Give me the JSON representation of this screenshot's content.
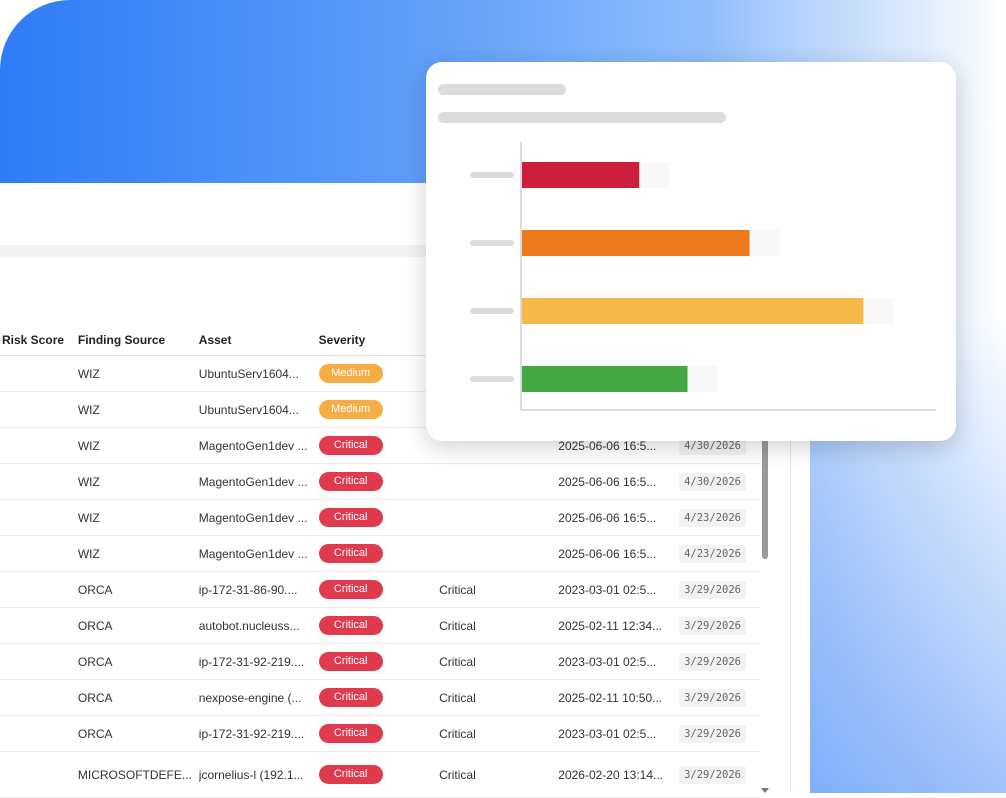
{
  "table": {
    "columns": [
      "Risk Score",
      "Finding Source",
      "Asset",
      "Severity",
      "",
      "",
      ""
    ],
    "rows": [
      {
        "source": "WIZ",
        "asset": "UbuntuServ1604...",
        "severity": "Medium",
        "severity_color": "#f6ad45",
        "severity2": "",
        "date": "",
        "due": ""
      },
      {
        "source": "WIZ",
        "asset": "UbuntuServ1604...",
        "severity": "Medium",
        "severity_color": "#f6ad45",
        "severity2": "",
        "date": "",
        "due": ""
      },
      {
        "source": "WIZ",
        "asset": "MagentoGen1dev ...",
        "severity": "Critical",
        "severity_color": "#e03a4e",
        "severity2": "",
        "date": "2025-06-06 16:5...",
        "due": "4/30/2026"
      },
      {
        "source": "WIZ",
        "asset": "MagentoGen1dev ...",
        "severity": "Critical",
        "severity_color": "#e03a4e",
        "severity2": "",
        "date": "2025-06-06 16:5...",
        "due": "4/30/2026"
      },
      {
        "source": "WIZ",
        "asset": "MagentoGen1dev ...",
        "severity": "Critical",
        "severity_color": "#e03a4e",
        "severity2": "",
        "date": "2025-06-06 16:5...",
        "due": "4/23/2026"
      },
      {
        "source": "WIZ",
        "asset": "MagentoGen1dev ...",
        "severity": "Critical",
        "severity_color": "#e03a4e",
        "severity2": "",
        "date": "2025-06-06 16:5...",
        "due": "4/23/2026"
      },
      {
        "source": "ORCA",
        "asset": "ip-172-31-86-90....",
        "severity": "Critical",
        "severity_color": "#e03a4e",
        "severity2": "Critical",
        "date": "2023-03-01 02:5...",
        "due": "3/29/2026"
      },
      {
        "source": "ORCA",
        "asset": "autobot.nucleuss...",
        "severity": "Critical",
        "severity_color": "#e03a4e",
        "severity2": "Critical",
        "date": "2025-02-11 12:34...",
        "due": "3/29/2026"
      },
      {
        "source": "ORCA",
        "asset": "ip-172-31-92-219....",
        "severity": "Critical",
        "severity_color": "#e03a4e",
        "severity2": "Critical",
        "date": "2023-03-01 02:5...",
        "due": "3/29/2026"
      },
      {
        "source": "ORCA",
        "asset": "nexpose-engine (...",
        "severity": "Critical",
        "severity_color": "#e03a4e",
        "severity2": "Critical",
        "date": "2025-02-11 10:50...",
        "due": "3/29/2026"
      },
      {
        "source": "ORCA",
        "asset": "ip-172-31-92-219....",
        "severity": "Critical",
        "severity_color": "#e03a4e",
        "severity2": "Critical",
        "date": "2023-03-01 02:5...",
        "due": "3/29/2026"
      },
      {
        "source": "MICROSOFTDEFE...",
        "asset": "jcornelius-l (192.1...",
        "severity": "Critical",
        "severity_color": "#e03a4e",
        "severity2": "Critical",
        "date": "2026-02-20 13:14...",
        "due": "3/29/2026"
      }
    ]
  },
  "chart_data": {
    "type": "bar",
    "orientation": "horizontal",
    "categories": [
      "",
      "",
      "",
      ""
    ],
    "values": [
      34,
      66,
      99,
      48
    ],
    "colors": [
      "#cc1f3b",
      "#ec7a1d",
      "#f7b84a",
      "#43a843"
    ],
    "xlim": [
      0,
      116
    ],
    "title": "",
    "xlabel": "",
    "ylabel": ""
  }
}
